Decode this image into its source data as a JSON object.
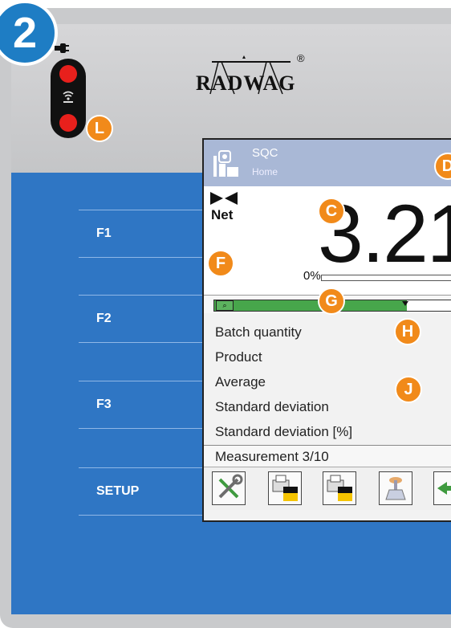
{
  "step": {
    "number": "2"
  },
  "brand": {
    "logo_text": "RADWAG",
    "trademark": "®"
  },
  "markers": {
    "l": "L",
    "c": "C",
    "d": "D",
    "f": "F",
    "g": "G",
    "h": "H",
    "j": "J"
  },
  "function_keys": [
    {
      "label": "F1"
    },
    {
      "label": "F2"
    },
    {
      "label": "F3"
    },
    {
      "label": "SETUP"
    }
  ],
  "screen": {
    "title": "SQC",
    "subtitle": "Home",
    "net_label": "Net",
    "reading": "3.21",
    "percent_label": "0%",
    "info_rows": [
      {
        "label": "Batch quantity"
      },
      {
        "label": "Product"
      },
      {
        "label": "Average"
      },
      {
        "label": "Standard deviation"
      },
      {
        "label": "Standard deviation [%]"
      }
    ],
    "measurement": "Measurement 3/10",
    "zone_fill_fraction": 0.8,
    "buttons": [
      {
        "icon": "tools-icon"
      },
      {
        "icon": "printer-icon"
      },
      {
        "icon": "printer-report-icon"
      },
      {
        "icon": "scale-load-icon"
      },
      {
        "icon": "export-icon"
      }
    ]
  },
  "colors": {
    "panel_blue": "#2f76c4",
    "marker_orange": "#f18a1a",
    "step_blue": "#1e7dc4",
    "zone_green": "#47a64b"
  }
}
